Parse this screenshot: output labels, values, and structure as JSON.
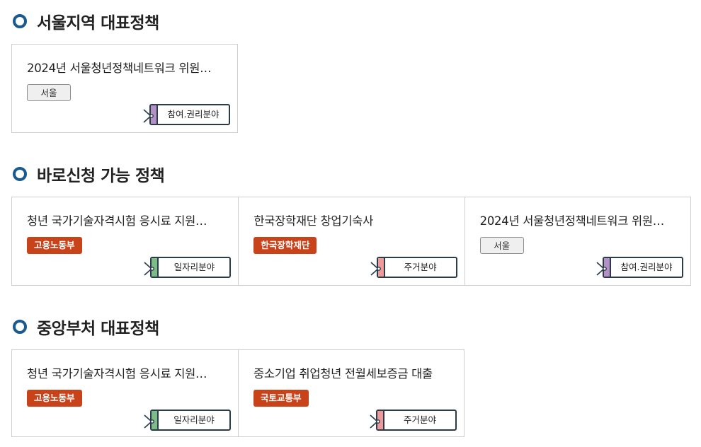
{
  "sections": [
    {
      "title": "서울지역 대표정책",
      "cards": [
        {
          "title": "2024년 서울청년정책네트워크 위원…",
          "region": "서울",
          "category": "참여.권리분야",
          "category_color": "#b590c6"
        }
      ]
    },
    {
      "title": "바로신청 가능 정책",
      "cards": [
        {
          "title": "청년 국가기술자격시험 응시료 지원…",
          "agency": "고용노동부",
          "category": "일자리분야",
          "category_color": "#7dbb87"
        },
        {
          "title": "한국장학재단 창업기숙사",
          "agency": "한국장학재단",
          "category": "주거분야",
          "category_color": "#ee9a98"
        },
        {
          "title": "2024년 서울청년정책네트워크 위원…",
          "region": "서울",
          "category": "참여.권리분야",
          "category_color": "#b590c6"
        }
      ]
    },
    {
      "title": "중앙부처 대표정책",
      "cards": [
        {
          "title": "청년 국가기술자격시험 응시료 지원…",
          "agency": "고용노동부",
          "category": "일자리분야",
          "category_color": "#7dbb87"
        },
        {
          "title": "중소기업 취업청년 전월세보증금 대출",
          "agency": "국토교통부",
          "category": "주거분야",
          "category_color": "#ee9a98"
        }
      ]
    }
  ],
  "colors": {
    "section_icon": "#1a5b8f",
    "agency_badge": "#c9431a",
    "region_badge_bg": "#efefef"
  }
}
